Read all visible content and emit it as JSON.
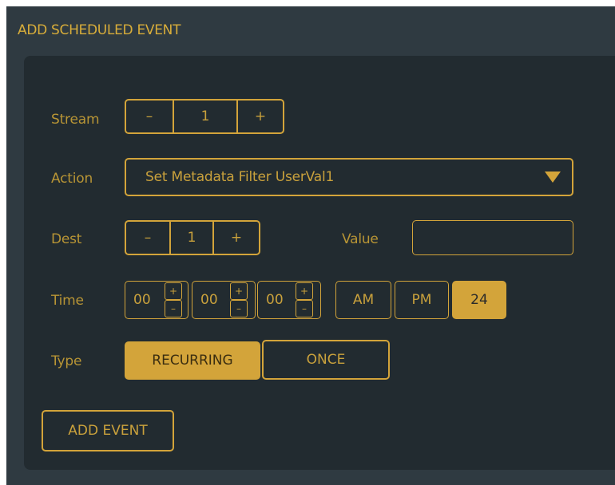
{
  "header": {
    "title": "ADD SCHEDULED EVENT"
  },
  "stream": {
    "label": "Stream",
    "minus": "–",
    "value": "1",
    "plus": "+"
  },
  "action": {
    "label": "Action",
    "selected": "Set Metadata Filter UserVal1"
  },
  "dest": {
    "label": "Dest",
    "minus": "–",
    "value": "1",
    "plus": "+"
  },
  "value_field": {
    "label": "Value",
    "value": ""
  },
  "time": {
    "label": "Time",
    "hours": "00",
    "minutes": "00",
    "seconds": "00",
    "inc": "+",
    "dec": "–",
    "am": "AM",
    "pm": "PM",
    "h24": "24",
    "selected_format": "24"
  },
  "type": {
    "label": "Type",
    "recurring": "RECURRING",
    "once": "ONCE",
    "selected": "RECURRING"
  },
  "add_event_label": "ADD EVENT",
  "colors": {
    "accent": "#d3a43a",
    "panel": "#222b30",
    "outer": "#2f3a41",
    "label": "#b89535"
  }
}
